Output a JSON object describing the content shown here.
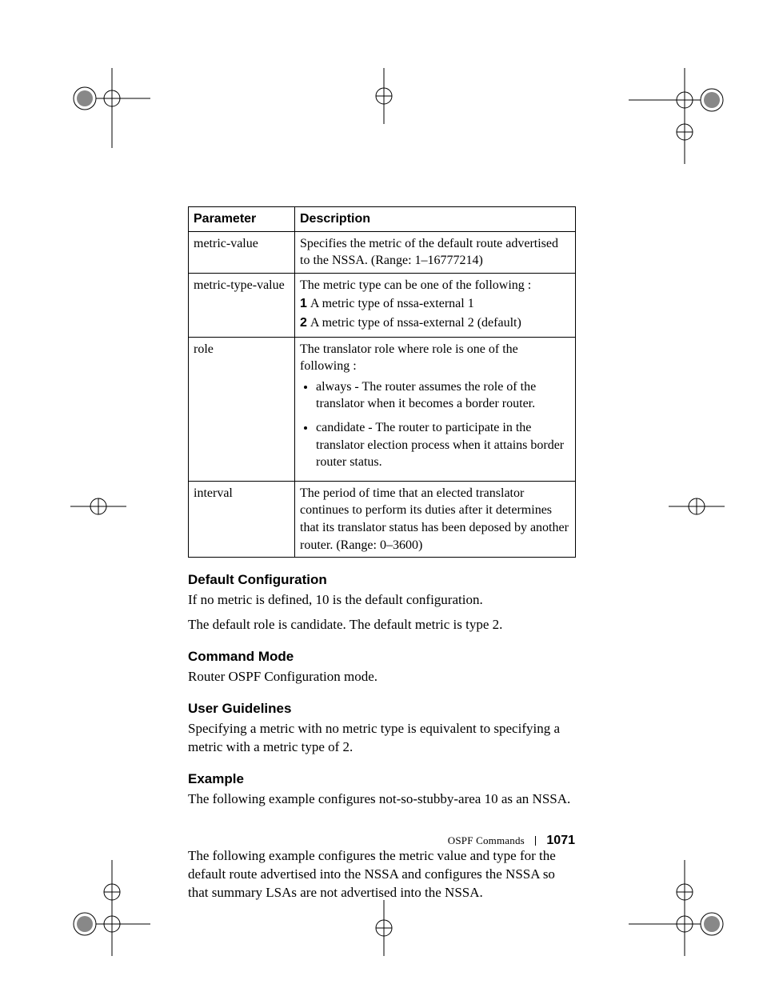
{
  "table": {
    "headers": [
      "Parameter",
      "Description"
    ],
    "rows": [
      {
        "param": "metric-value",
        "desc_plain": "Specifies the metric of the default route advertised to the NSSA. (Range: 1–16777214)"
      },
      {
        "param": "metric-type-value",
        "desc_lead": "The metric type can be one of the following :",
        "list_ordered": [
          {
            "n": "1",
            "t": "A metric type of nssa-external 1"
          },
          {
            "n": "2",
            "t": "A metric type of nssa-external 2 (default)"
          }
        ]
      },
      {
        "param": "role",
        "desc_lead": "The translator role where role is one of the following :",
        "list_bullets": [
          "always - The router assumes the role of the translator when it becomes a border router.",
          "candidate - The router to participate in the translator election process when it attains border router status."
        ]
      },
      {
        "param": "interval",
        "desc_plain": "The period of time that an elected translator continues to perform its duties after it determines that its translator status has been deposed by another router. (Range: 0–3600)"
      }
    ]
  },
  "sections": {
    "default_cfg": {
      "h": "Default Configuration",
      "p1": "If no metric is defined, 10 is the default configuration.",
      "p2": "The default role is candidate. The default metric is type 2."
    },
    "command_mode": {
      "h": "Command Mode",
      "p1": "Router OSPF Configuration mode."
    },
    "user_guidelines": {
      "h": "User Guidelines",
      "p1": "Specifying a metric with no metric type is equivalent to specifying a metric with a metric type of 2."
    },
    "example": {
      "h": "Example",
      "p1": "The following example configures not-so-stubby-area 10 as an NSSA.",
      "p2": "The following example configures the metric value and type for the default route advertised into the NSSA and configures the NSSA so that summary LSAs are not advertised into the NSSA."
    }
  },
  "footer": {
    "section": "OSPF Commands",
    "page": "1071"
  }
}
